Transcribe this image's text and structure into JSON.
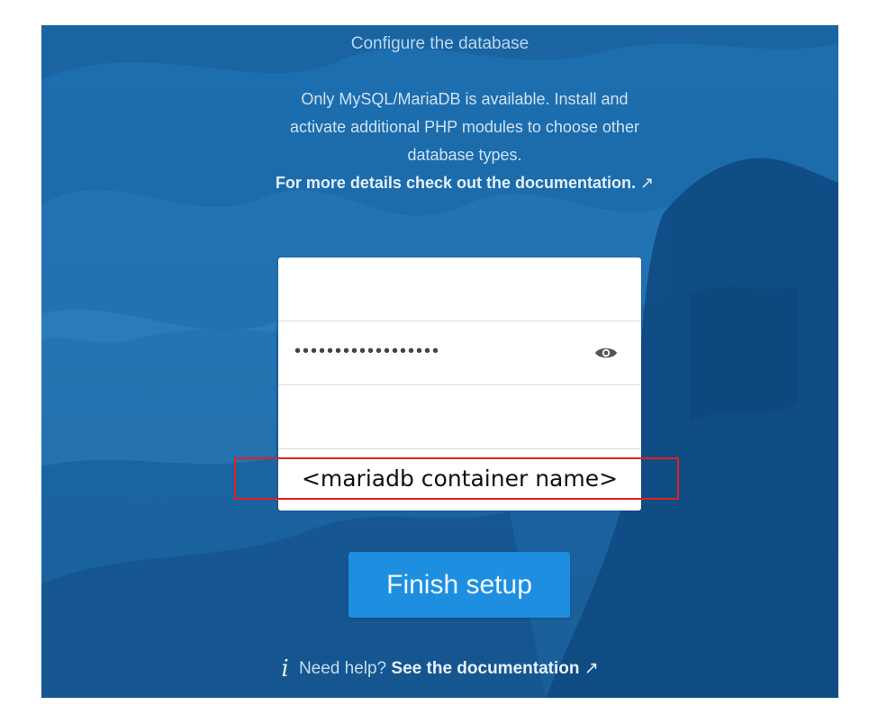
{
  "header": {
    "section_title": "Configure the database"
  },
  "info": {
    "line1": "Only MySQL/MariaDB is available. Install and activate additional PHP modules to choose other database types.",
    "docs_link": "For more details check out the documentation.",
    "docs_arrow": "↗"
  },
  "form": {
    "db_user_value": "",
    "db_password_mask": "••••••••••••••••••",
    "show_password_icon": "eye-icon",
    "db_name_value": "",
    "db_host_value": "<mariadb container name>"
  },
  "annotation": {
    "color": "#e02020"
  },
  "actions": {
    "finish_label": "Finish setup"
  },
  "help": {
    "icon": "i",
    "prefix": "Need help?",
    "link_label": "See the documentation",
    "arrow": "↗"
  },
  "colors": {
    "background": "#1b68a6",
    "button": "#1e8fe0",
    "card": "#ffffff"
  }
}
